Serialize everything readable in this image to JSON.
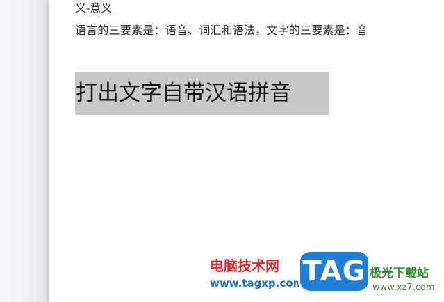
{
  "document": {
    "line1": "义-意义",
    "line2": "语言的三要素是：语音、词汇和语法，文字的三要素是：音",
    "heading": "打出文字自带汉语拼音"
  },
  "watermark": {
    "site_name": "电脑技术网",
    "site_url": "www.tagxp.com",
    "tag_logo": "TAG",
    "tag_sub": "极光下载站",
    "tag_url": "www.xz7.com"
  }
}
